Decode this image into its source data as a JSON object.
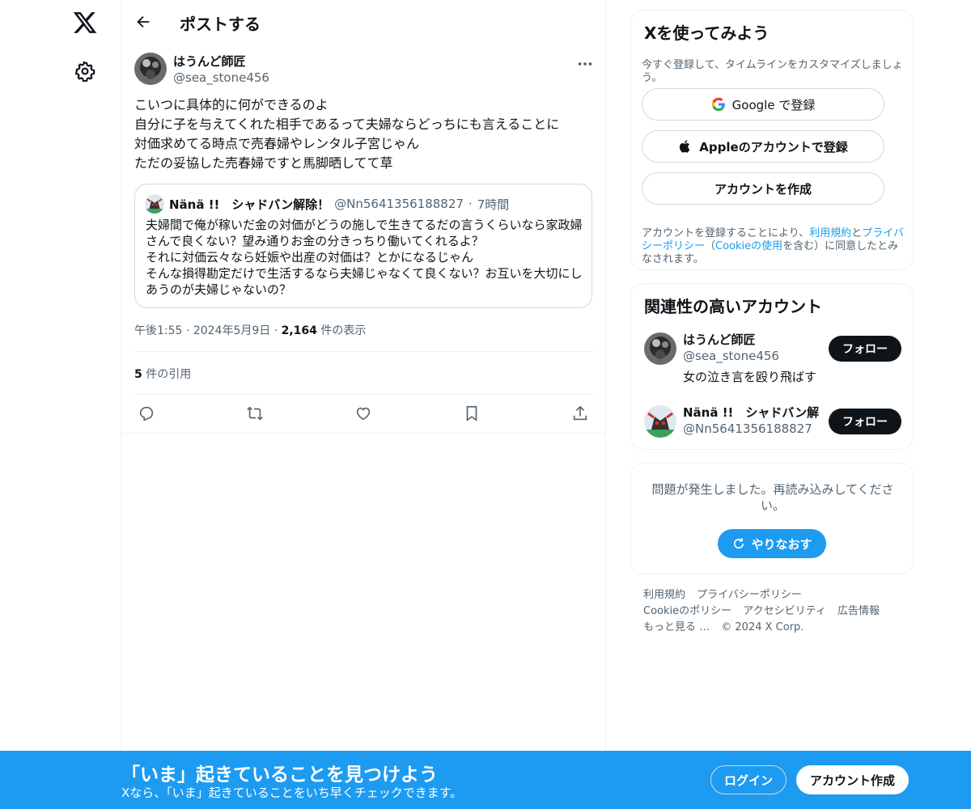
{
  "header": {
    "title": "ポストする"
  },
  "post": {
    "author_name": "はうんど師匠",
    "author_handle": "@sea_stone456",
    "text": "こいつに具体的に何ができるのよ\n自分に子を与えてくれた相手であるって夫婦ならどっちにも言えることに\n対価求めてる時点で売春婦やレンタル子宮じゃん\nただの妥協した売春婦ですと馬脚晒してて草",
    "time": "午後1:55",
    "date": "2024年5月9日",
    "views_count": "2,164",
    "views_label": "件の表示",
    "quotes_count": "5",
    "quotes_label": "件の引用"
  },
  "quote": {
    "name": "Nänä !!　シャドバン解除！",
    "handle": "@Nn5641356188827",
    "age": "7時間",
    "text": "夫婦間で俺が稼いだ金の対価がどうの施しで生きてるだの言うくらいなら家政婦さんで良くない？望み通りお金の分きっちり働いてくれるよ？\nそれに対価云々なら妊娠や出産の対価は？とかになるじゃん\nそんな損得勘定だけで生活するなら夫婦じゃなくて良くない？お互いを大切にしあうのが夫婦じゃないの？"
  },
  "signup": {
    "title": "Xを使ってみよう",
    "desc": "今すぐ登録して、タイムラインをカスタマイズしましょう。",
    "google_label": "Google で登録",
    "apple_label": "Appleのアカウントで登録",
    "create_label": "アカウントを作成",
    "legal_1": "アカウントを登録することにより、",
    "legal_terms": "利用規約",
    "legal_2": "と",
    "legal_privacy": "プライバシーポリシー",
    "legal_3": "（",
    "legal_cookie": "Cookieの使用",
    "legal_4": "を含む）に同意したとみなされます。"
  },
  "related": {
    "title": "関連性の高いアカウント",
    "accounts": [
      {
        "name": "はうんど師匠",
        "handle": "@sea_stone456",
        "bio": "女の泣き言を殴り飛ばす",
        "follow": "フォロー"
      },
      {
        "name": "Nänä !!　シャドバン解除",
        "handle": "@Nn5641356188827",
        "bio": "",
        "follow": "フォロー"
      }
    ]
  },
  "error": {
    "message": "問題が発生しました。再読み込みしてください。",
    "retry": "やりなおす"
  },
  "footer": {
    "links": [
      "利用規約",
      "プライバシーポリシー",
      "Cookieのポリシー",
      "アクセシビリティ",
      "広告情報",
      "もっと見る …"
    ],
    "copyright": "© 2024 X Corp."
  },
  "banner": {
    "heading": "「いま」起きていることを見つけよう",
    "sub": "Xなら、「いま」起きていることをいち早くチェックできます。",
    "login": "ログイン",
    "signup": "アカウント作成"
  },
  "colors": {
    "accent": "#1d9bf0",
    "text": "#0f1419",
    "muted": "#536471",
    "border": "#cfd9de"
  },
  "icons": [
    "x-logo",
    "gear-icon",
    "back-arrow-icon",
    "more-icon",
    "reply-icon",
    "retweet-icon",
    "like-icon",
    "bookmark-icon",
    "share-icon",
    "google-icon",
    "apple-icon",
    "refresh-icon"
  ]
}
